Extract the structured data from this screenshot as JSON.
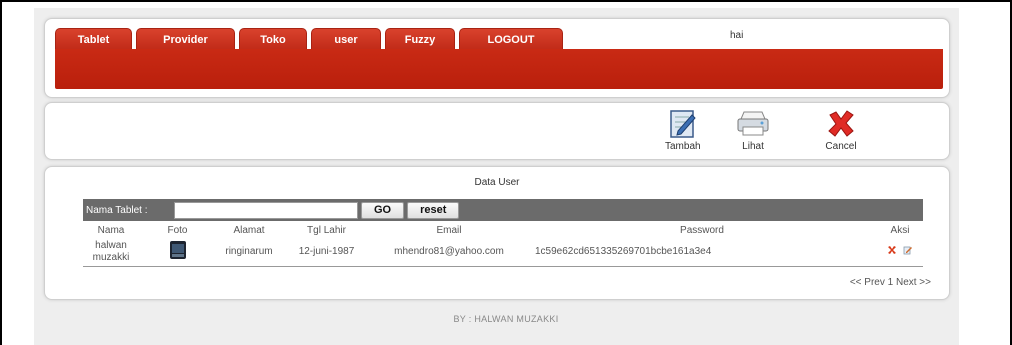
{
  "nav": {
    "tabs": [
      {
        "label": "Tablet"
      },
      {
        "label": "Provider"
      },
      {
        "label": "Toko"
      },
      {
        "label": "user"
      },
      {
        "label": "Fuzzy"
      },
      {
        "label": "LOGOUT"
      }
    ],
    "greeting": "hai"
  },
  "actions": {
    "tambah": "Tambah",
    "lihat": "Lihat",
    "cancel": "Cancel"
  },
  "data": {
    "title": "Data User",
    "search_label": "Nama Tablet :",
    "search_value": "",
    "go_label": "GO",
    "reset_label": "reset",
    "columns": [
      "Nama",
      "Foto",
      "Alamat",
      "Tgl Lahir",
      "Email",
      "Password",
      "Aksi"
    ],
    "rows": [
      {
        "nama": "halwan muzakki",
        "alamat": "ringinarum",
        "tgl_lahir": "12-juni-1987",
        "email": "mhendro81@yahoo.com",
        "password": "1c59e62cd651335269701bcbe161a3e4"
      }
    ],
    "pager": "<< Prev 1 Next >>"
  },
  "footer": "BY : HALWAN MUZAKKI",
  "colors": {
    "accent_red": "#c92a14",
    "search_bar": "#6b6b6b"
  },
  "icons": {
    "tambah": "edit-note-icon",
    "lihat": "printer-icon",
    "cancel": "x-cross-icon",
    "row_delete": "delete-icon",
    "row_edit": "edit-icon"
  }
}
